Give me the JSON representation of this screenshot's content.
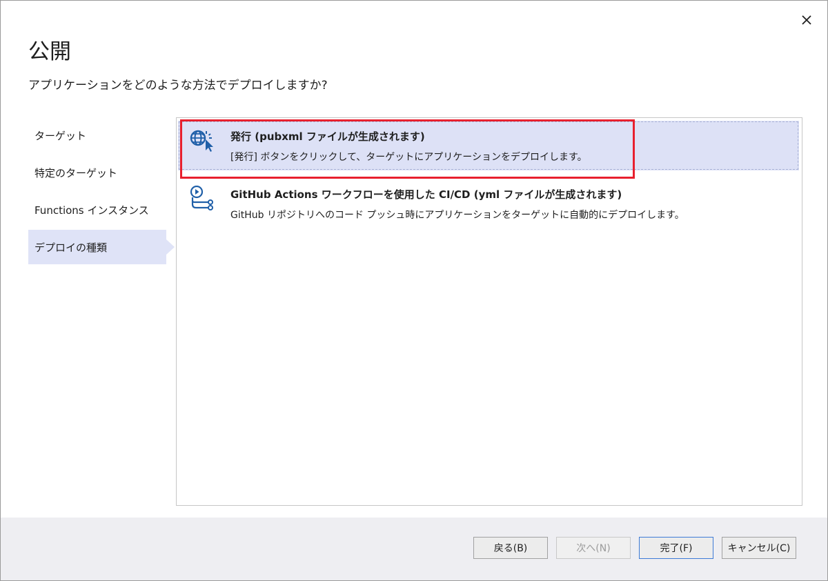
{
  "dialog": {
    "title": "公開",
    "subtitle": "アプリケーションをどのような方法でデプロイしますか?"
  },
  "nav": {
    "items": [
      {
        "label": "ターゲット"
      },
      {
        "label": "特定のターゲット"
      },
      {
        "label": "Functions インスタンス"
      },
      {
        "label": "デプロイの種類"
      }
    ],
    "active_index": 3
  },
  "options": [
    {
      "title": "発行 (pubxml ファイルが生成されます)",
      "description": "[発行] ボタンをクリックして、ターゲットにアプリケーションをデプロイします。",
      "icon": "publish-globe-icon",
      "selected": true
    },
    {
      "title": "GitHub Actions ワークフローを使用した CI/CD (yml ファイルが生成されます)",
      "description": "GitHub リポジトリへのコード プッシュ時にアプリケーションをターゲットに自動的にデプロイします。",
      "icon": "github-actions-workflow-icon",
      "selected": false
    }
  ],
  "footer": {
    "back_label": "戻る(B)",
    "next_label": "次へ(N)",
    "finish_label": "完了(F)",
    "cancel_label": "キャンセル(C)"
  },
  "colors": {
    "accent": "#1f6fc5",
    "selected_bg": "#dde1f6",
    "highlight_border": "#e8202e",
    "footer_bg": "#eeeef2"
  }
}
